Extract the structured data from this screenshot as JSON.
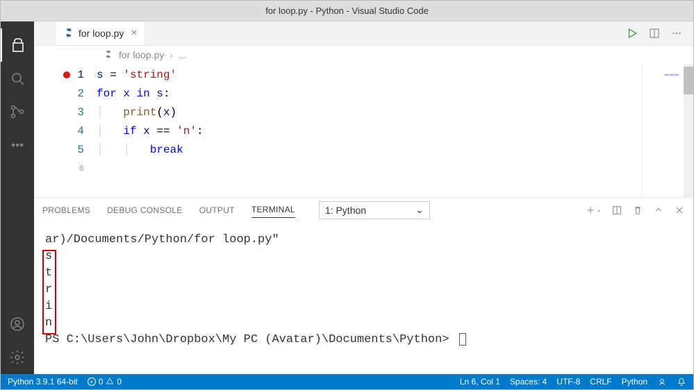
{
  "title": "for loop.py - Python - Visual Studio Code",
  "tab": {
    "label": "for loop.py",
    "close": "×"
  },
  "breadcrumb": {
    "file": "for loop.py",
    "more": "..."
  },
  "gutter": {
    "lines": [
      "1",
      "2",
      "3",
      "4",
      "5",
      "6"
    ]
  },
  "code": {
    "l1_var": "s",
    "l1_eq": " = ",
    "l1_str": "'string'",
    "l2_for": "for",
    "l2_x": " x ",
    "l2_in": "in",
    "l2_s": " s",
    "l2_colon": ":",
    "l3_fn": "print",
    "l3_open": "(",
    "l3_arg": "x",
    "l3_close": ")",
    "l4_if": "if",
    "l4_x": " x ",
    "l4_eq": "==",
    "l4_sp": " ",
    "l4_str": "'n'",
    "l4_colon": ":",
    "l5_kw": "break"
  },
  "panel": {
    "tabs": {
      "problems": "PROBLEMS",
      "debug": "DEBUG CONSOLE",
      "output": "OUTPUT",
      "terminal": "TERMINAL"
    },
    "selector": "1: Python"
  },
  "terminal": {
    "line0": "ar)/Documents/Python/for loop.py\"",
    "out": [
      "s",
      "t",
      "r",
      "i",
      "n"
    ],
    "prompt": "PS C:\\Users\\John\\Dropbox\\My PC (Avatar)\\Documents\\Python> "
  },
  "status": {
    "python": "Python 3.9.1 64-bit",
    "errors": "0",
    "warnings": "0",
    "cursor": "Ln 6, Col 1",
    "spaces": "Spaces: 4",
    "encoding": "UTF-8",
    "eol": "CRLF",
    "lang": "Python"
  }
}
